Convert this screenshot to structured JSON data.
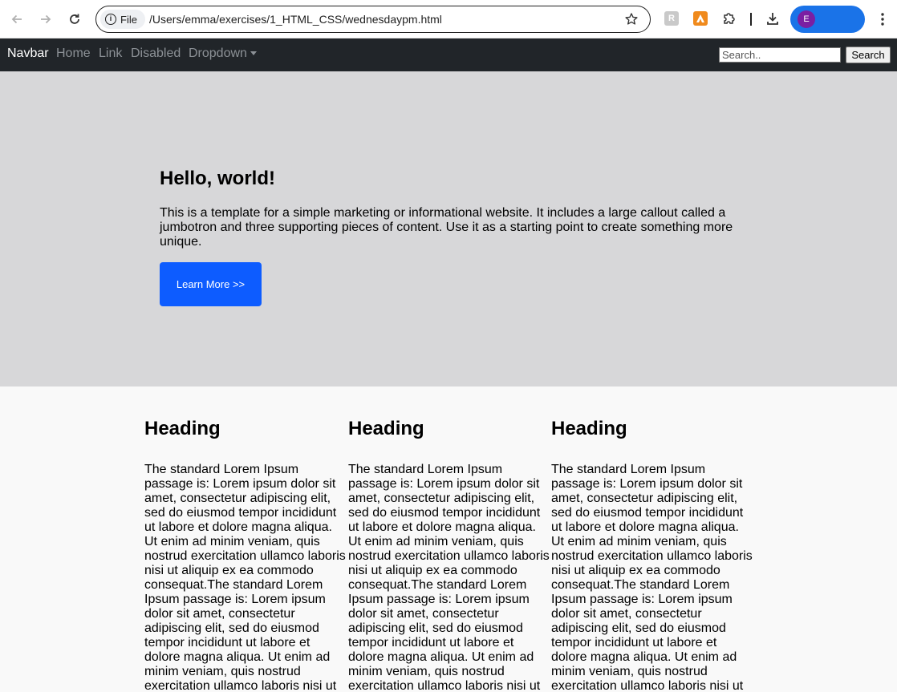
{
  "browser": {
    "chip_label": "File",
    "url": "/Users/emma/exercises/1_HTML_CSS/wednesdaypm.html",
    "profile_initial": "E",
    "ext1_glyph": "R"
  },
  "navbar": {
    "brand": "Navbar",
    "links": [
      "Home",
      "Link",
      "Disabled",
      "Dropdown"
    ],
    "search_placeholder": "Search..",
    "search_button": "Search"
  },
  "jumbotron": {
    "title": "Hello, world!",
    "text": "This is a template for a simple marketing or informational website. It includes a large callout called a jumbotron and three supporting pieces of content. Use it as a starting point to create something more unique.",
    "button": "Learn More >>"
  },
  "columns": [
    {
      "heading": "Heading",
      "text": "The standard Lorem Ipsum passage is: Lorem ipsum dolor sit amet, consectetur adipiscing elit, sed do eiusmod tempor incididunt ut labore et dolore magna aliqua. Ut enim ad minim veniam, quis nostrud exercitation ullamco laboris nisi ut aliquip ex ea commodo consequat.The standard Lorem Ipsum passage is: Lorem ipsum dolor sit amet, consectetur adipiscing elit, sed do eiusmod tempor incididunt ut labore et dolore magna aliqua. Ut enim ad minim veniam, quis nostrud exercitation ullamco laboris nisi ut aliquip ex ea commodo consequat."
    },
    {
      "heading": "Heading",
      "text": "The standard Lorem Ipsum passage is: Lorem ipsum dolor sit amet, consectetur adipiscing elit, sed do eiusmod tempor incididunt ut labore et dolore magna aliqua. Ut enim ad minim veniam, quis nostrud exercitation ullamco laboris nisi ut aliquip ex ea commodo consequat.The standard Lorem Ipsum passage is: Lorem ipsum dolor sit amet, consectetur adipiscing elit, sed do eiusmod tempor incididunt ut labore et dolore magna aliqua. Ut enim ad minim veniam, quis nostrud exercitation ullamco laboris nisi ut aliquip ex ea commodo consequat."
    },
    {
      "heading": "Heading",
      "text": "The standard Lorem Ipsum passage is: Lorem ipsum dolor sit amet, consectetur adipiscing elit, sed do eiusmod tempor incididunt ut labore et dolore magna aliqua. Ut enim ad minim veniam, quis nostrud exercitation ullamco laboris nisi ut aliquip ex ea commodo consequat.The standard Lorem Ipsum passage is: Lorem ipsum dolor sit amet, consectetur adipiscing elit, sed do eiusmod tempor incididunt ut labore et dolore magna aliqua. Ut enim ad minim veniam, quis nostrud exercitation ullamco laboris nisi ut aliquip ex ea commodo consequat."
    }
  ],
  "colors": {
    "navbar_bg": "#212529",
    "jumbotron_bg": "#d7d7d9",
    "button_bg": "#0d5cff",
    "profile_bg": "#1a73e8"
  },
  "icons": [
    "back-arrow-icon",
    "forward-arrow-icon",
    "reload-icon",
    "info-icon",
    "star-icon",
    "extension-icon",
    "download-icon",
    "kebab-menu-icon",
    "dropdown-caret-icon"
  ]
}
